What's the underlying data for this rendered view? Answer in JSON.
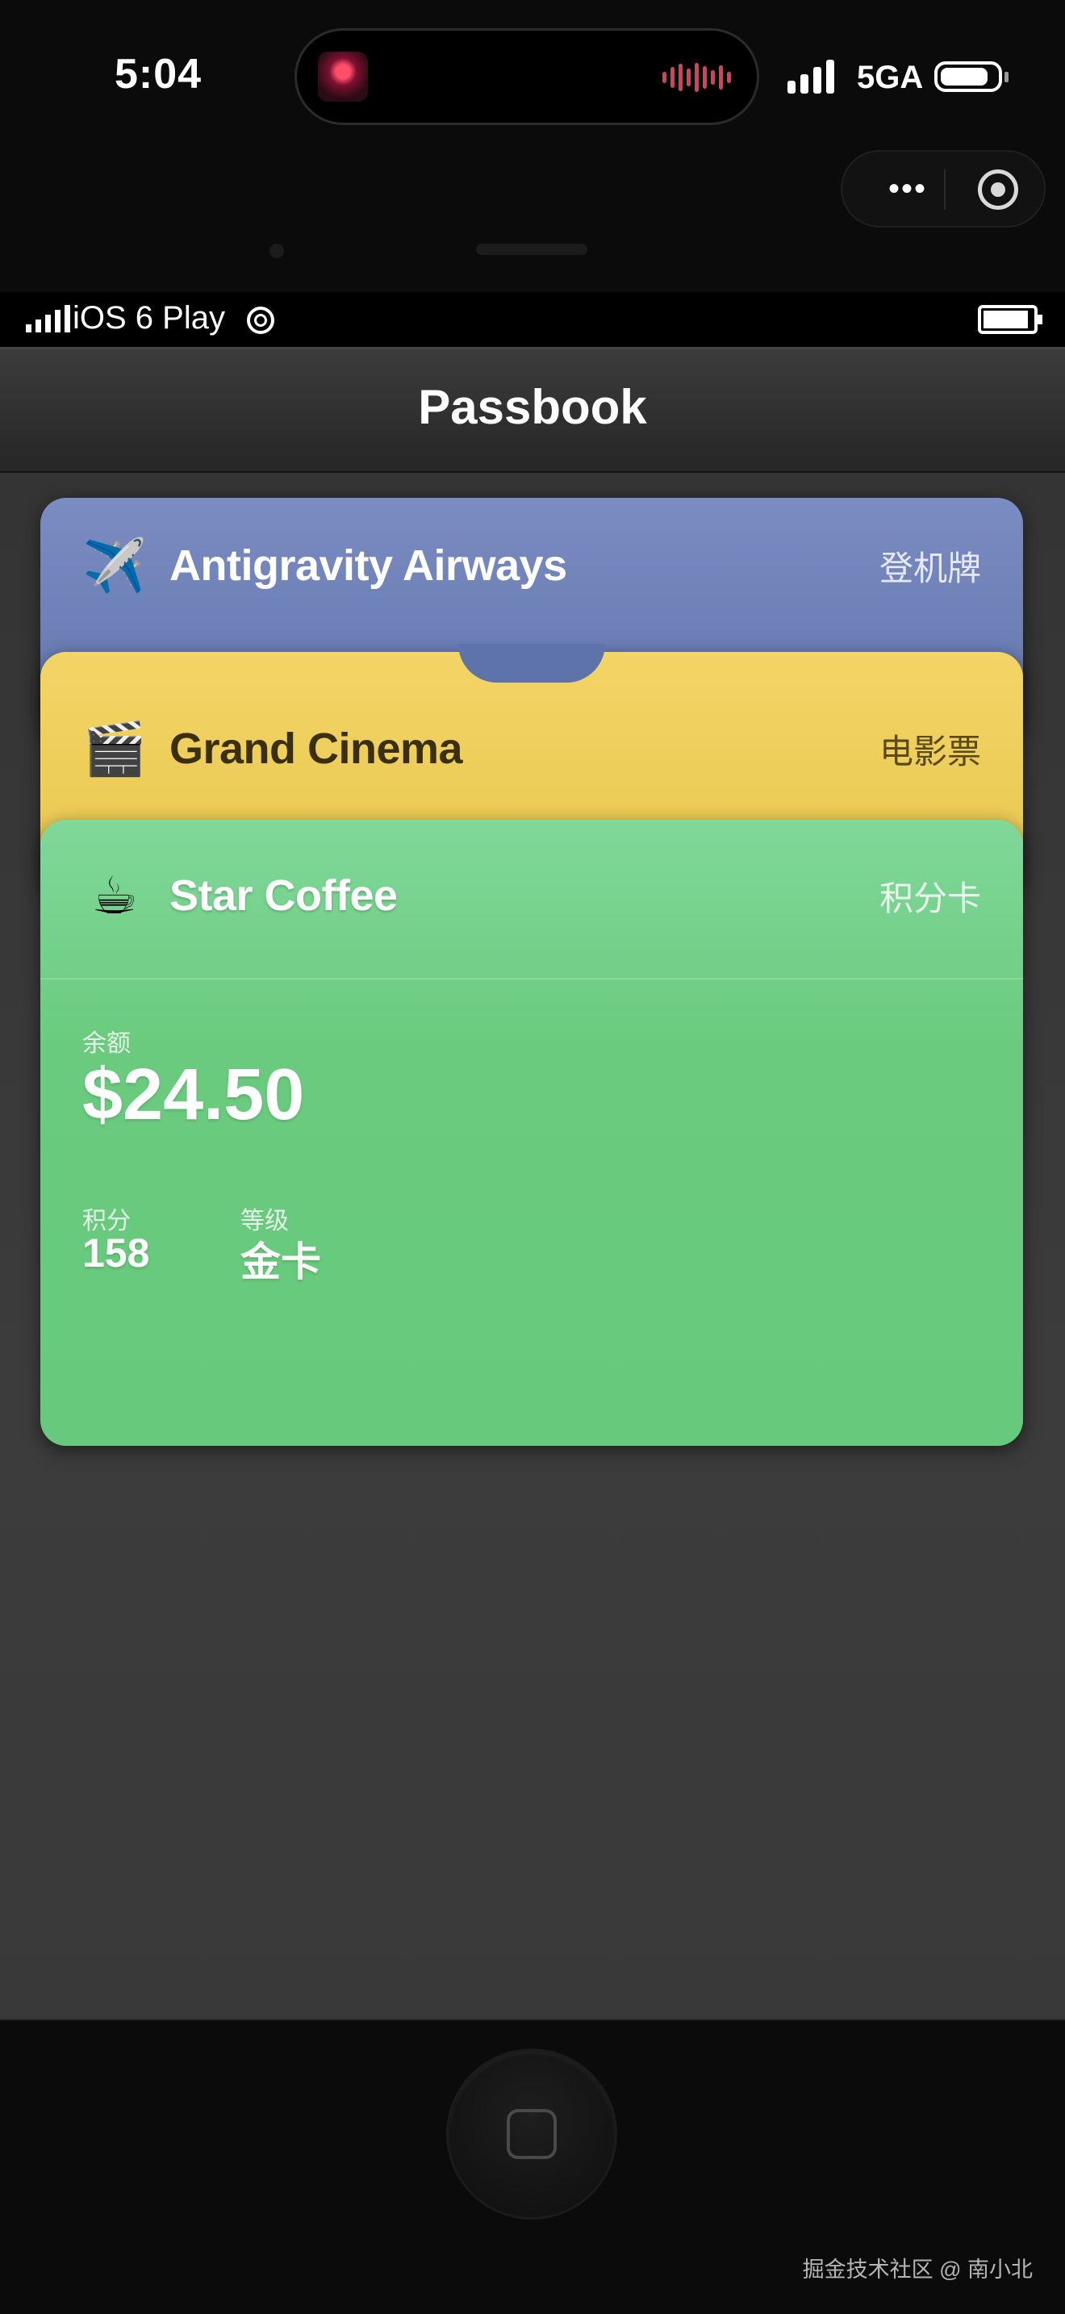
{
  "device_status": {
    "time": "5:04",
    "network": "5GA"
  },
  "ios_status": {
    "carrier": "iOS 6 Play"
  },
  "navbar": {
    "title": "Passbook"
  },
  "passes": [
    {
      "emoji": "✈️",
      "name": "Antigravity Airways",
      "type": "登机牌",
      "color": "#6b7fb6"
    },
    {
      "emoji": "🎬",
      "name": "Grand Cinema",
      "type": "电影票",
      "color": "#eccd57"
    },
    {
      "emoji": "☕",
      "name": "Star Coffee",
      "type": "积分卡",
      "color": "#6acb7e"
    }
  ],
  "coffee_card": {
    "balance_label": "余额",
    "balance_value": "$24.50",
    "points_label": "积分",
    "points_value": "158",
    "level_label": "等级",
    "level_value": "金卡"
  },
  "watermark": "掘金技术社区 @ 南小北",
  "icons": {
    "signal": "signal-bars-icon",
    "battery": "battery-icon",
    "more": "more-dots-icon",
    "close": "close-target-icon",
    "wifi": "wifi-icon",
    "home": "home-button-icon"
  }
}
